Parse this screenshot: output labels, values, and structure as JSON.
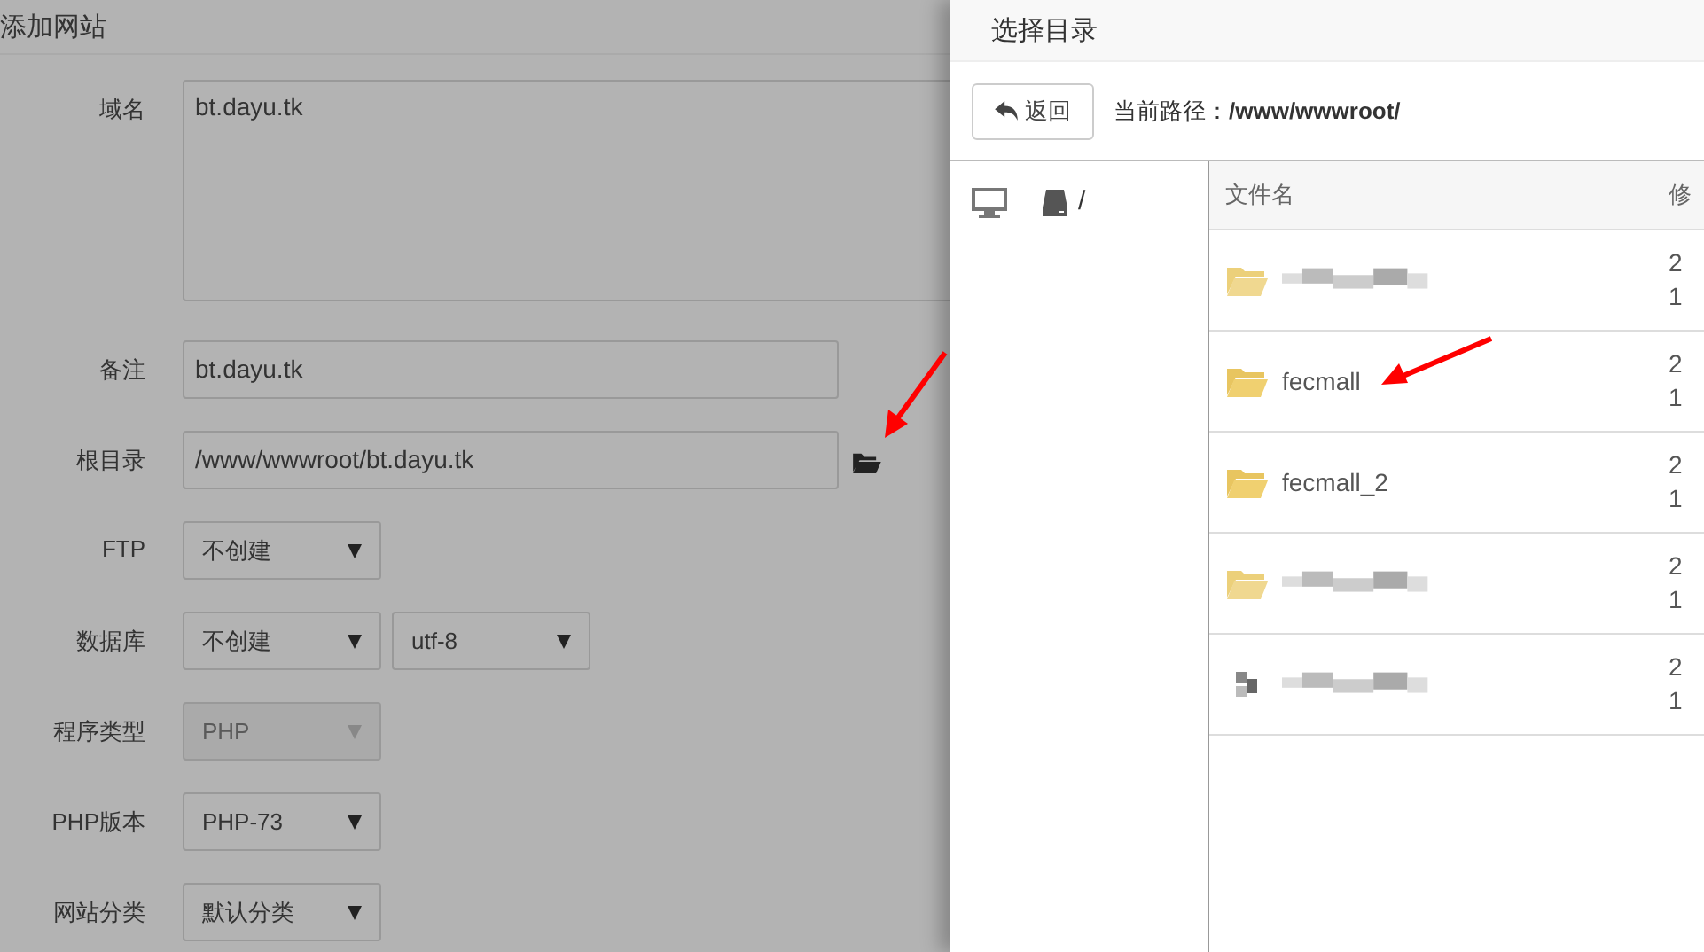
{
  "form": {
    "title": "添加网站",
    "fields": [
      {
        "kind": "textarea",
        "label": "域名",
        "value": "bt.dayu.tk"
      },
      {
        "kind": "text",
        "label": "备注",
        "value": "bt.dayu.tk"
      },
      {
        "kind": "path",
        "label": "根目录",
        "value": "/www/wwwroot/bt.dayu.tk"
      },
      {
        "kind": "select",
        "label": "FTP",
        "selects": [
          {
            "value": "不创建",
            "disabled": false
          }
        ]
      },
      {
        "kind": "select",
        "label": "数据库",
        "selects": [
          {
            "value": "不创建",
            "disabled": false
          },
          {
            "value": "utf-8",
            "disabled": false
          }
        ]
      },
      {
        "kind": "select",
        "label": "程序类型",
        "selects": [
          {
            "value": "PHP",
            "disabled": true
          }
        ]
      },
      {
        "kind": "select",
        "label": "PHP版本",
        "selects": [
          {
            "value": "PHP-73",
            "disabled": false
          }
        ]
      },
      {
        "kind": "select",
        "label": "网站分类",
        "selects": [
          {
            "value": "默认分类",
            "disabled": false
          }
        ]
      }
    ]
  },
  "picker": {
    "title": "选择目录",
    "back_button": "返回",
    "current_path": "当前路径：**/www/wwwroot/**",
    "tree_root": "/",
    "columns": [
      "文件名",
      "修"
    ],
    "rows": [
      {
        "kind": "blurred",
        "name": "",
        "column_2": [
          "2",
          "1"
        ]
      },
      {
        "kind": "folder",
        "name": "fecmall",
        "column_2": [
          "2",
          "1"
        ]
      },
      {
        "kind": "folder",
        "name": "fecmall_2",
        "column_2": [
          "2",
          "1"
        ]
      },
      {
        "kind": "blurred",
        "name": "",
        "column_2": [
          "2",
          "1"
        ]
      },
      {
        "kind": "blurred-file",
        "name": "",
        "column_2": [
          "2",
          "1"
        ]
      }
    ]
  }
}
